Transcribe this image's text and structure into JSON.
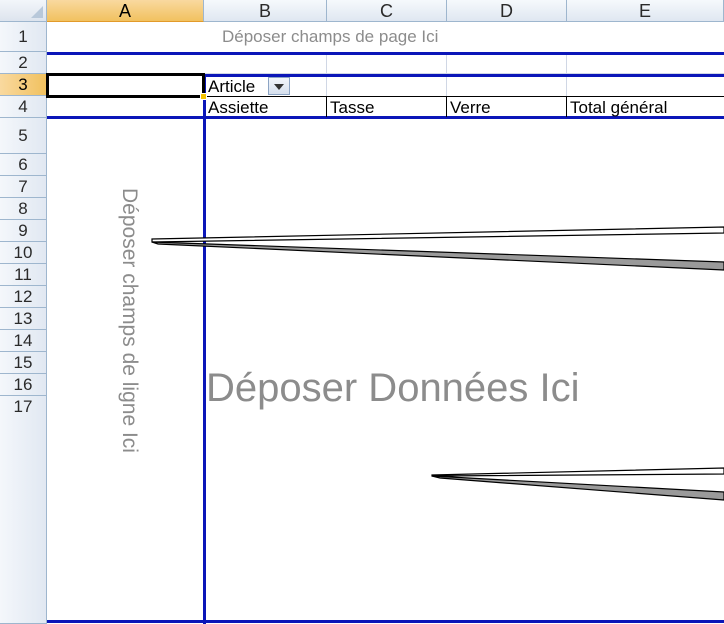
{
  "columns": [
    "A",
    "B",
    "C",
    "D",
    "E"
  ],
  "rows": [
    "1",
    "2",
    "3",
    "4",
    "5",
    "6",
    "7",
    "8",
    "9",
    "10",
    "11",
    "12",
    "13",
    "14",
    "15",
    "16",
    "17"
  ],
  "selected_cell": {
    "column": "A",
    "row": "3"
  },
  "pivot": {
    "page_drop_zone": "Déposer champs de page Ici",
    "row_drop_zone": "Déposer champs de ligne Ici",
    "data_drop_zone": "Déposer Données Ici",
    "column_field": "Article",
    "column_items": [
      "Assiette",
      "Tasse",
      "Verre",
      "Total général"
    ]
  },
  "colors": {
    "pivot_border": "#0b16b8",
    "selected_header": "#f1c15f",
    "gridline": "#d0d7e5",
    "drop_text": "#8c8c8c"
  }
}
